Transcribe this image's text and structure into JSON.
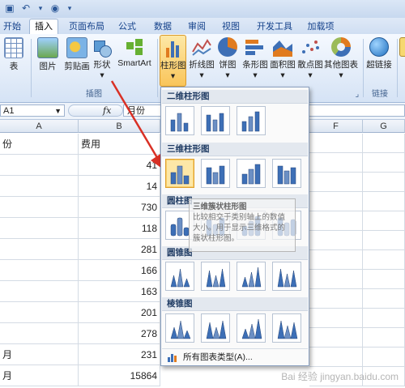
{
  "quick_access": {
    "icon1": "save-icon",
    "icon2": "undo-icon",
    "icon3": "dropdown-icon"
  },
  "tabs": [
    "开始",
    "插入",
    "页面布局",
    "公式",
    "数据",
    "审阅",
    "视图",
    "开发工具",
    "加载项"
  ],
  "active_tab": "插入",
  "ribbon": {
    "table_group": {
      "table": "表"
    },
    "illustrations": {
      "label": "插图",
      "picture": "图片",
      "clipart": "剪贴画",
      "shapes": "形状",
      "smartart": "SmartArt"
    },
    "charts": {
      "column": "柱形图",
      "line": "折线图",
      "pie": "饼图",
      "bar": "条形图",
      "area": "面积图",
      "scatter": "散点图",
      "other": "其他图表"
    },
    "links": {
      "label": "链接",
      "hyperlink": "超链接"
    }
  },
  "formula_bar": {
    "name_box": "A1",
    "fx": "fx",
    "value": "月份"
  },
  "columns": {
    "A": "A",
    "B": "B",
    "F": "F",
    "G": "G"
  },
  "rows": [
    {
      "a": "份",
      "b": "费用"
    },
    {
      "a": "",
      "b": "41"
    },
    {
      "a": "",
      "b": "14"
    },
    {
      "a": "",
      "b": "730"
    },
    {
      "a": "",
      "b": "118"
    },
    {
      "a": "",
      "b": "281"
    },
    {
      "a": "",
      "b": "166"
    },
    {
      "a": "",
      "b": "163"
    },
    {
      "a": "",
      "b": "201"
    },
    {
      "a": "",
      "b": "278"
    },
    {
      "a": "月",
      "b": "231"
    },
    {
      "a": "月",
      "b": "15864"
    }
  ],
  "dropdown": {
    "sections": [
      "二维柱形图",
      "三维柱形图",
      "圆柱图",
      "圆锥图",
      "棱锥图"
    ],
    "all_chart_types": "所有图表类型(A)..."
  },
  "tooltip": {
    "title": "三维簇状柱形图",
    "body": "比较相交于类别轴上的数值大小。用于显示三维格式的簇状柱形图。"
  },
  "watermark": "Bai 经验 jingyan.baidu.com",
  "colors": {
    "accent": "#15428b",
    "selected": "#fde7a7",
    "arrow": "#d93025"
  }
}
